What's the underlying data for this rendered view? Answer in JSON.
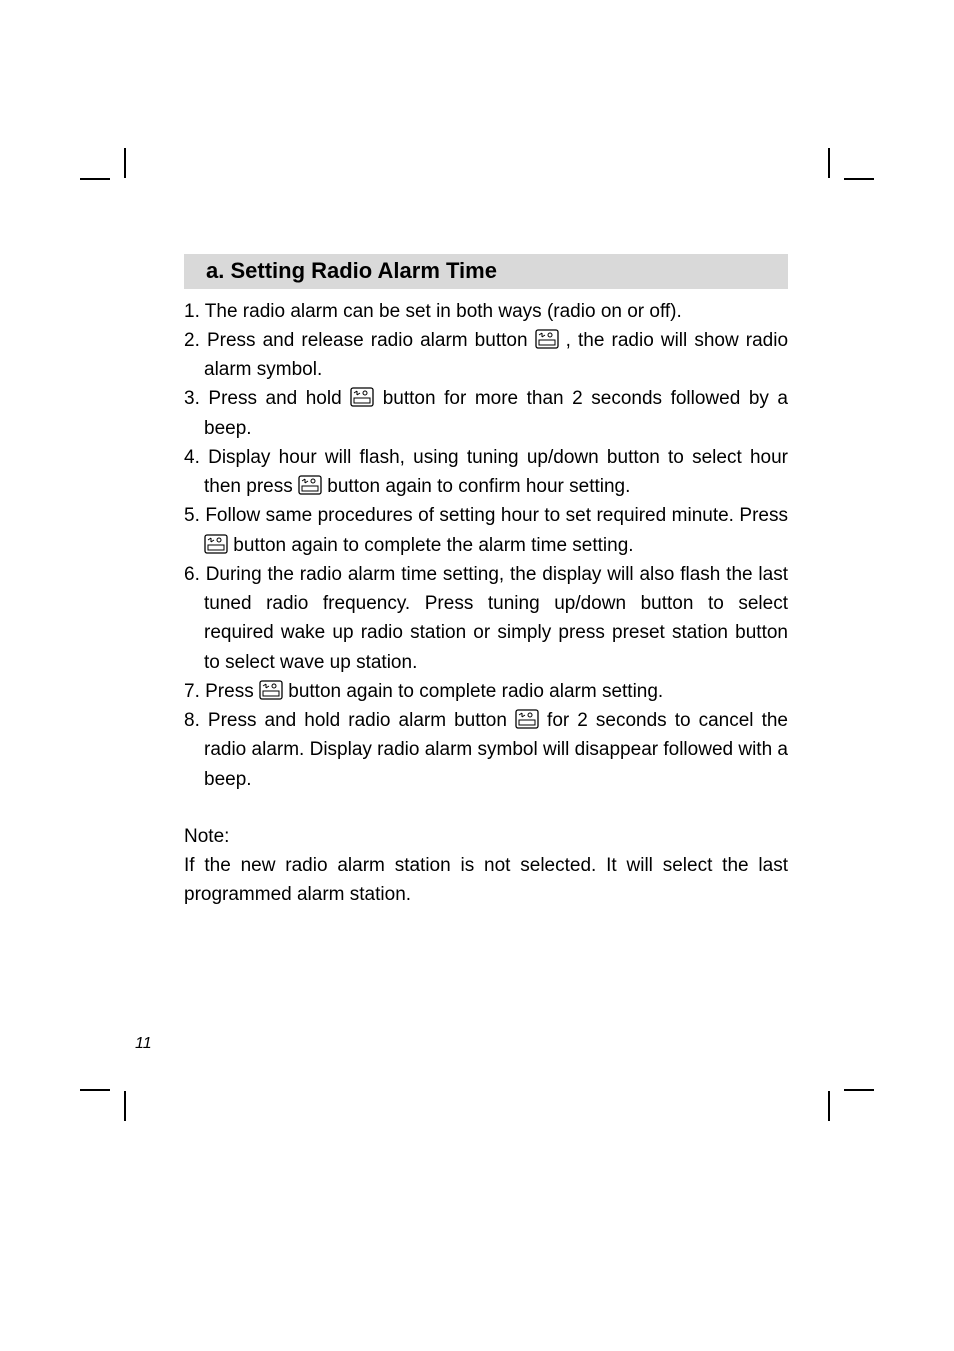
{
  "heading": "a. Setting Radio Alarm Time",
  "steps": {
    "s1n": "1. ",
    "s1": "The radio alarm can be set in both ways (radio on or off).",
    "s2n": "2. ",
    "s2a": "Press and release radio alarm button ",
    "s2b": " , the radio will show radio alarm symbol.",
    "s3n": "3. ",
    "s3a": "Press and hold ",
    "s3b": " button for more than 2 seconds followed by a beep.",
    "s4n": "4. ",
    "s4a": "Display hour will flash, using tuning up/down button to select hour then press ",
    "s4b": " button again to confirm hour setting.",
    "s5n": "5. ",
    "s5a": "Follow same procedures of setting hour to set required minute. Press ",
    "s5b": " button again to complete the alarm time setting.",
    "s6n": "6. ",
    "s6": "During the radio alarm time setting, the display will also flash the last tuned radio frequency. Press tuning up/down button to select required wake up radio station or simply press preset station button to select wave up station.",
    "s7n": "7. ",
    "s7a": "Press ",
    "s7b": " button again to complete radio alarm setting.",
    "s8n": "8. ",
    "s8a": "Press and hold radio alarm button ",
    "s8b": " for 2 seconds to cancel the radio alarm. Display radio alarm symbol will disappear followed with a beep."
  },
  "note_label": "Note:",
  "note_body": "If the new radio alarm station is not selected. It will select the last programmed alarm station.",
  "page_number": "11",
  "icon_name": "radio-alarm-icon"
}
